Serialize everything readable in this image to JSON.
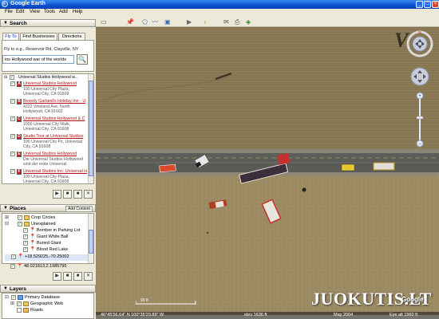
{
  "window": {
    "title": "Google Earth",
    "minimize": "_",
    "maximize": "□",
    "close": "×"
  },
  "menu": [
    "File",
    "Edit",
    "View",
    "Tools",
    "Add",
    "Help"
  ],
  "toolbar_icons": [
    "sidebar-icon",
    "placemark-icon",
    "polygon-icon",
    "path-icon",
    "overlay-icon",
    "tour-icon",
    "sky-icon",
    "email-icon",
    "print-icon",
    "maps-icon"
  ],
  "search": {
    "header": "Search",
    "tabs": [
      "Fly To",
      "Find Businesses",
      "Directions"
    ],
    "fly_label": "Fly to e.g., Reservoir Rd, Clayville, NY",
    "query": "ios Hollywood war of the worlds",
    "root_label": "Universal Studios Hollywood w...",
    "results": [
      {
        "marker": "A",
        "name": "Universal Studios Hollywood",
        "addr1": "100 Universal City Plaza,",
        "addr2": "Universal City, CA 91608",
        "color": "#c81e1e"
      },
      {
        "marker": "B",
        "name": "Beverly Garland's Holiday Inn - U",
        "addr1": "4222 Vineland Ave, North",
        "addr2": "Hollywood, CA 91602",
        "color": "#c81e1e"
      },
      {
        "marker": "C",
        "name": "Universal Studios Hollywood & C",
        "addr1": "1000 Universal City Walk,",
        "addr2": "Universal City, CA 91608",
        "color": "#c81e1e"
      },
      {
        "marker": "D",
        "name": "Studio Tour at Universal Studios",
        "addr1": "100 Universal City Pz, Universal",
        "addr2": "City, CA 91608",
        "color": "#c81e1e"
      },
      {
        "marker": "E",
        "name": "Universal Studios Hollywood",
        "addr1": "Die Universal Studios Hollywood",
        "addr2": "sind der erste Universal",
        "color": "#c81e1e"
      },
      {
        "marker": "F",
        "name": "Universal Studios Inc: Universal H",
        "addr1": "100 Universal City Plaza,",
        "addr2": "Universal City, CA 91608",
        "color": "#c81e1e"
      }
    ]
  },
  "places": {
    "header": "Places",
    "add_content": "Add Content",
    "items": [
      {
        "label": "Crop Circles",
        "icon": "folder-icon"
      },
      {
        "label": "Unexplained",
        "icon": "folder-icon"
      },
      {
        "label": "Bomber in Parking Lot",
        "icon": "pushpin-icon"
      },
      {
        "label": "Giant White Ball",
        "icon": "pushpin-icon"
      },
      {
        "label": "Buried Giant",
        "icon": "pushpin-icon"
      },
      {
        "label": "Blood Red Lake",
        "icon": "pushpin-icon"
      },
      {
        "label": "+18.529225,-70.25002",
        "icon": "pushpin-icon"
      },
      {
        "label": "48.021813,2.1985795",
        "icon": "pushpin-icon"
      }
    ]
  },
  "layers": {
    "header": "Layers",
    "items": [
      {
        "label": "Primary Database"
      },
      {
        "label": "Geographic Web"
      },
      {
        "label": "Roads"
      }
    ]
  },
  "map": {
    "scale_label": "99 ft",
    "status_coords": "46°45'56.64\" N  100°35'29.89\" W",
    "status_elev": "elev 1636 ft",
    "status_date": "May 2004",
    "status_eye": "Eye alt  1960 ft",
    "logo_letter": "V",
    "watermark": "JUOKUTIS.LT",
    "google_tag": "Google"
  }
}
